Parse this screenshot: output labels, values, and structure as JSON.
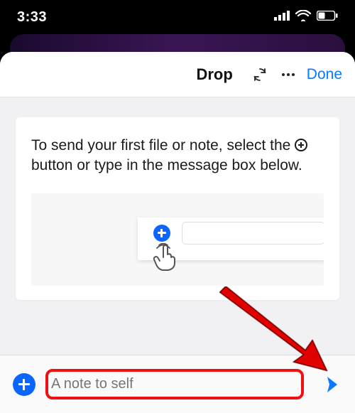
{
  "status": {
    "time": "3:33"
  },
  "nav": {
    "title": "Drop",
    "done": "Done"
  },
  "card": {
    "instruction_pre": "To send your first file or note, select the ",
    "instruction_post": " button or type in the message box below."
  },
  "composer": {
    "placeholder": "A note to self"
  },
  "icons": {
    "sync": "sync-icon",
    "more": "more-icon",
    "signal": "signal-icon",
    "wifi": "wifi-icon",
    "battery": "battery-icon",
    "plus": "plus-icon",
    "send": "send-icon",
    "tap": "tap-gesture-icon"
  },
  "annotations": {
    "highlight": "note-input-highlight",
    "arrow": "send-arrow"
  }
}
